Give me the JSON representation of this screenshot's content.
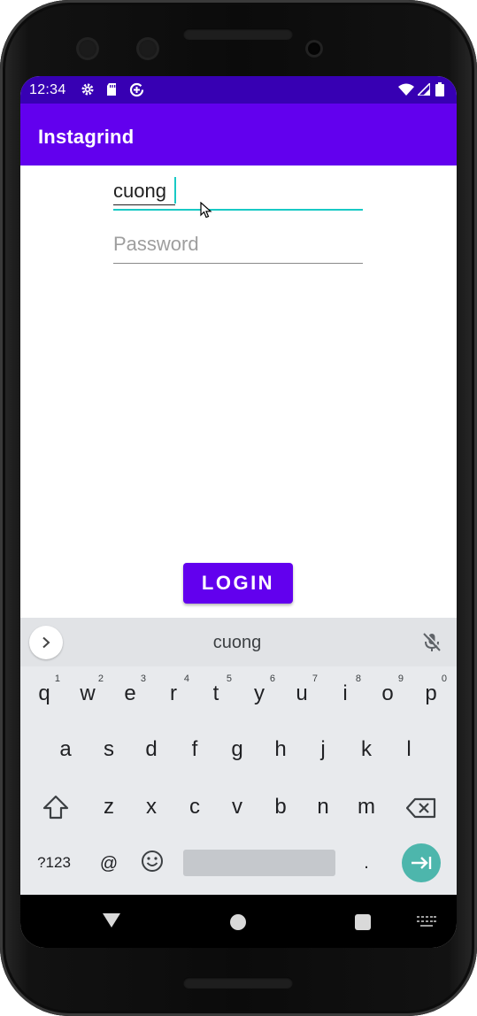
{
  "status_bar": {
    "time": "12:34",
    "left_icons": [
      "gear-icon",
      "sd-card-icon",
      "data-saver-icon"
    ],
    "right_icons": [
      "wifi-icon",
      "signal-icon",
      "battery-icon"
    ]
  },
  "app_bar": {
    "title": "Instagrind"
  },
  "form": {
    "username_value": "cuong",
    "password_placeholder": "Password",
    "login_label": "LOGIN"
  },
  "keyboard": {
    "suggestion": "cuong",
    "row1": [
      {
        "key": "q",
        "hint": "1"
      },
      {
        "key": "w",
        "hint": "2"
      },
      {
        "key": "e",
        "hint": "3"
      },
      {
        "key": "r",
        "hint": "4"
      },
      {
        "key": "t",
        "hint": "5"
      },
      {
        "key": "y",
        "hint": "6"
      },
      {
        "key": "u",
        "hint": "7"
      },
      {
        "key": "i",
        "hint": "8"
      },
      {
        "key": "o",
        "hint": "9"
      },
      {
        "key": "p",
        "hint": "0"
      }
    ],
    "row2": [
      "a",
      "s",
      "d",
      "f",
      "g",
      "h",
      "j",
      "k",
      "l"
    ],
    "row3": [
      "z",
      "x",
      "c",
      "v",
      "b",
      "n",
      "m"
    ],
    "symbols_label": "?123",
    "at_label": "@",
    "period_label": "."
  },
  "colors": {
    "status_bar": "#3700b3",
    "primary": "#6200ee",
    "accent": "#18c9c5",
    "enter_key": "#4db6ac"
  }
}
